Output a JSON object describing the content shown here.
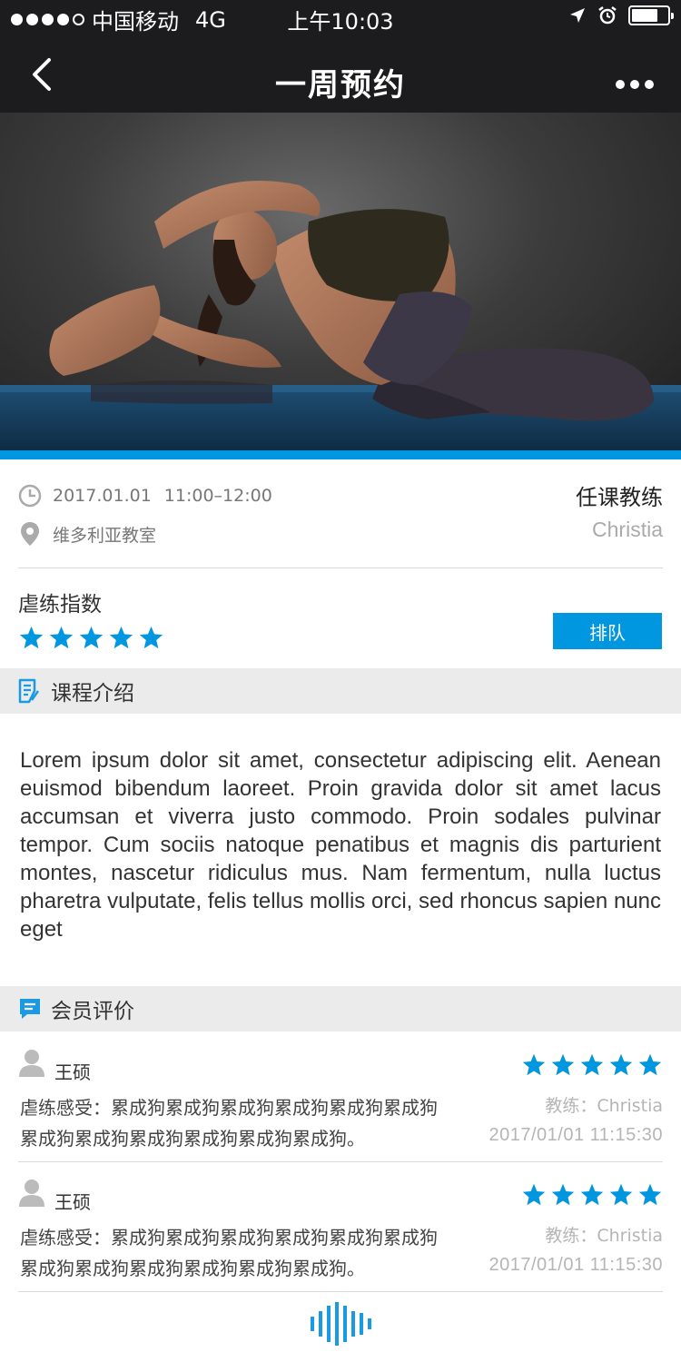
{
  "status_bar": {
    "carrier": "中国移动",
    "network": "4G",
    "time": "上午10:03",
    "signal_strength": 4,
    "signal_total": 5,
    "icons": [
      "location-arrow-icon",
      "alarm-icon",
      "battery-icon"
    ]
  },
  "nav": {
    "title": "一周预约",
    "back_icon": "chevron-left-icon",
    "more_icon": "more-dots-icon"
  },
  "hero": {
    "accent_color": "#0096e0"
  },
  "course": {
    "date": "2017.01.01",
    "time": "11:00–12:00",
    "location": "维多利亚教室",
    "coach_label": "任课教练",
    "coach_name": "Christia",
    "intensity_label": "虐练指数",
    "intensity_rating": 5,
    "intensity_max": 5,
    "queue_button": "排队"
  },
  "intro": {
    "title": "课程介绍",
    "icon": "document-edit-icon",
    "text": "Lorem ipsum dolor sit amet, consectetur adipiscing elit. Aenean euismod bibendum laoreet. Proin gravida dolor sit amet lacus accumsan et viverra justo commodo. Proin sodales pulvinar tempor. Cum sociis natoque penatibus et magnis dis parturient montes, nascetur ridiculus mus. Nam fermentum, nulla luctus pharetra vulputate, felis tellus mollis orci, sed rhoncus sapien nunc eget"
  },
  "reviews": {
    "title": "会员评价",
    "icon": "comment-icon",
    "items": [
      {
        "name": "王硕",
        "rating": 5,
        "feel_line1": "虐练感受：累成狗累成狗累成狗累成狗累成狗累成狗",
        "feel_line2": "累成狗累成狗累成狗累成狗累成狗累成狗。",
        "coach": "教练：Christia",
        "time": "2017/01/01 11:15:30"
      },
      {
        "name": "王硕",
        "rating": 5,
        "feel_line1": "虐练感受：累成狗累成狗累成狗累成狗累成狗累成狗",
        "feel_line2": "累成狗累成狗累成狗累成狗累成狗累成狗。",
        "coach": "教练：Christia",
        "time": "2017/01/01 11:15:30"
      }
    ]
  },
  "colors": {
    "accent": "#0096e0",
    "dark_bar": "#1c1c1e",
    "section_bg": "#ebebeb",
    "muted_text": "#aaaaaa"
  },
  "footer": {
    "icon": "sound-wave-icon"
  }
}
